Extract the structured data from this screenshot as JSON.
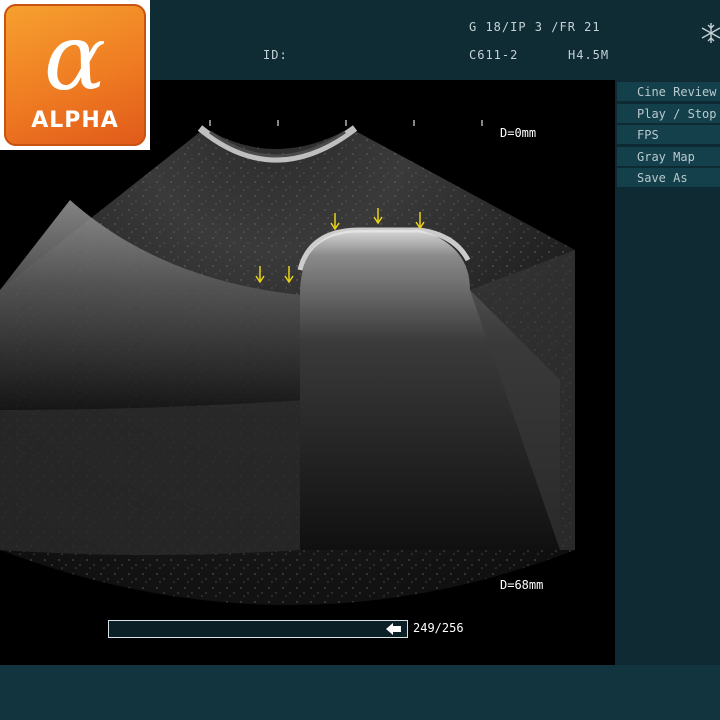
{
  "header": {
    "id_label": "ID:",
    "params_line1": "G 18/IP 3 /FR 21",
    "probe": "C611-2",
    "frequency": "H4.5M",
    "freeze_icon": "snowflake-icon"
  },
  "logo": {
    "glyph": "α",
    "word": "ALPHA",
    "colors": {
      "orange": "#ef7b22",
      "text": "#ffffff"
    }
  },
  "image": {
    "depth_top": "D=0mm",
    "depth_bottom": "D=68mm",
    "marker_color": "#e8d21a"
  },
  "menu": {
    "items": [
      "Cine Review",
      "Play / Stop",
      "FPS",
      "Gray Map",
      "Save As"
    ]
  },
  "cine": {
    "progress": 0.97,
    "frame_count": "249/256",
    "arrow_icon": "back-arrow-icon"
  }
}
